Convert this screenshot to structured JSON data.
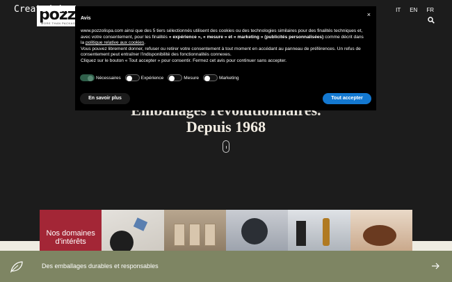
{
  "watermark": "Created in",
  "logo": {
    "name": "pozzo",
    "tagline": "MORE THAN PACKAGING"
  },
  "languages": [
    "IT",
    "EN",
    "FR"
  ],
  "icons": {
    "search": "search-icon",
    "close": "close-icon",
    "leaf": "leaf-icon",
    "arrow": "arrow-right-icon"
  },
  "hero": {
    "line1": "Emballages révolutionnaires.",
    "line2": "Depuis 1968"
  },
  "tiles": {
    "label_line1": "Nos domaines",
    "label_line2": "d'intérêts"
  },
  "bottom_bar": {
    "text": "Des emballages durables et responsables"
  },
  "cookie_dialog": {
    "title": "Avis",
    "close": "×",
    "p1_a": "www.pozzolispa.com ainsi que des 5 tiers sélectionnés utilisent des cookies ou des technologies similaires pour des finalités techniques et, avec votre consentement, pour les finalités ",
    "p1_b": "« expérience », « mesure » et « marketing » (publicités personnalisées)",
    "p1_c": " comme décrit dans la ",
    "p1_link": "politique relative aux cookies",
    "p1_d": ".",
    "p2": "Vous pouvez librement donner, refuser ou retirer votre consentement à tout moment en accédant au panneau de préférences. Un refus de consentement peut entraîner l'indisponibilité des fonctionnalités connexes.",
    "p3": "Cliquez sur le bouton « Tout accepter » pour consentir. Fermez cet avis pour continuer sans accepter.",
    "toggles": [
      {
        "label": "Nécessaires",
        "on": true
      },
      {
        "label": "Expérience",
        "on": false
      },
      {
        "label": "Mesure",
        "on": false
      },
      {
        "label": "Marketing",
        "on": false
      }
    ],
    "more_button": "En savoir plus",
    "accept_button": "Tout accepter"
  },
  "colors": {
    "accent_blue": "#1378d0",
    "tile_red": "#a32636",
    "bar_green": "#7e8563",
    "page_bg": "#1c1c1c"
  }
}
